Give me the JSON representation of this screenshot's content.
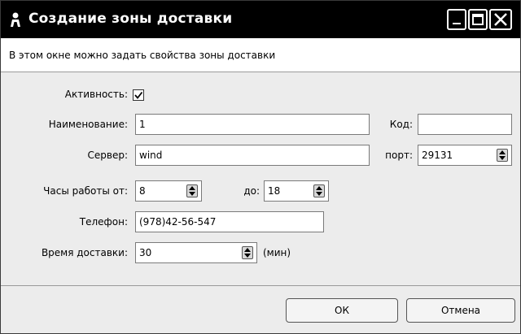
{
  "window": {
    "title": "Создание зоны доставки",
    "description": "В этом окне можно задать свойства зоны доставки"
  },
  "form": {
    "active_label": "Активность:",
    "active_checked": true,
    "name_label": "Наименование:",
    "name_value": "1",
    "code_label": "Код:",
    "code_value": "",
    "server_label": "Сервер:",
    "server_value": "wind",
    "port_label": "порт:",
    "port_value": "29131",
    "hours_from_label": "Часы работы от:",
    "hours_from_value": "8",
    "hours_to_label": "до:",
    "hours_to_value": "18",
    "phone_label": "Телефон:",
    "phone_value": "(978)42-56-547",
    "delivery_time_label": "Время доставки:",
    "delivery_time_value": "30",
    "delivery_time_unit": "(мин)"
  },
  "buttons": {
    "ok": "ОК",
    "cancel": "Отмена"
  },
  "icons": {
    "app": "person-icon",
    "minimize": "minimize-icon",
    "maximize": "maximize-icon",
    "close": "close-icon",
    "spinner": "spinner-arrows-icon",
    "check": "check-icon"
  }
}
